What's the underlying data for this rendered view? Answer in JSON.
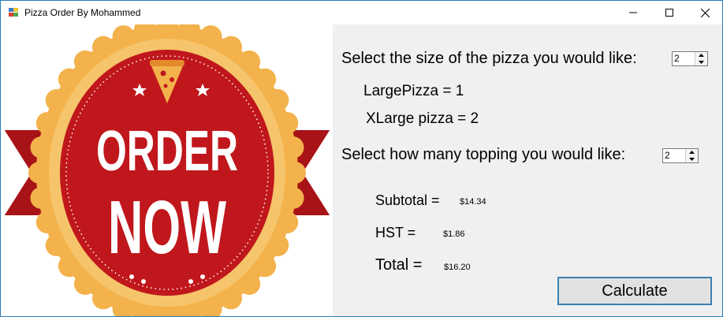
{
  "window": {
    "title": "Pizza Order By Mohammed"
  },
  "image": {
    "line1": "ORDER",
    "line2": "NOW",
    "colors": {
      "red": "#c0171c",
      "dark_red": "#8e0e12",
      "gold": "#f3b24b",
      "white": "#ffffff"
    }
  },
  "form": {
    "size_prompt": "Select the size of the pizza you would like:",
    "size_value": "2",
    "option_large": "LargePizza = 1",
    "option_xlarge": "XLarge pizza = 2",
    "topping_prompt": "Select how many topping you would like:",
    "topping_value": "2",
    "subtotal_label": "Subtotal =",
    "subtotal_value": "$14.34",
    "hst_label": "HST =",
    "hst_value": "$1.86",
    "total_label": "Total =",
    "total_value": "$16.20",
    "calculate_label": "Calculate"
  },
  "icons": [
    "app-icon",
    "minimize-icon",
    "maximize-icon",
    "close-icon",
    "spin-up-icon",
    "spin-down-icon"
  ]
}
